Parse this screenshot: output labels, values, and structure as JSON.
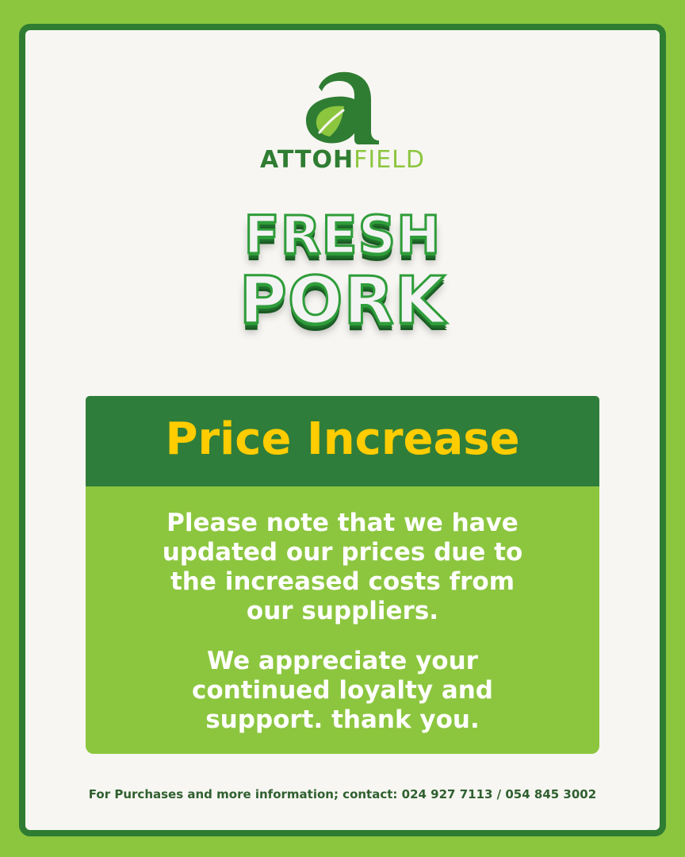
{
  "brand": {
    "logo_icon": "leaf-letter-a-icon",
    "name_part1": "ATTOH",
    "name_part2": "FIELD",
    "colors": {
      "dark_green": "#2f7d32",
      "light_green": "#8cc63f"
    }
  },
  "headline": {
    "line1": "FRESH",
    "line2": "PORK"
  },
  "notice": {
    "title": "Price Increase",
    "paragraph1": "Please note that we have\nupdated our prices due to\nthe increased costs from\nour suppliers.",
    "paragraph2": "We appreciate your\ncontinued loyalty and\nsupport. thank you.",
    "colors": {
      "title_bg": "#2f7d3a",
      "title_text": "#ffcc00",
      "body_bg": "#8cc63f",
      "body_text": "#ffffff"
    }
  },
  "footer": {
    "contact": "For Purchases and more information; contact: 024 927 7113 / 054 845 3002"
  }
}
